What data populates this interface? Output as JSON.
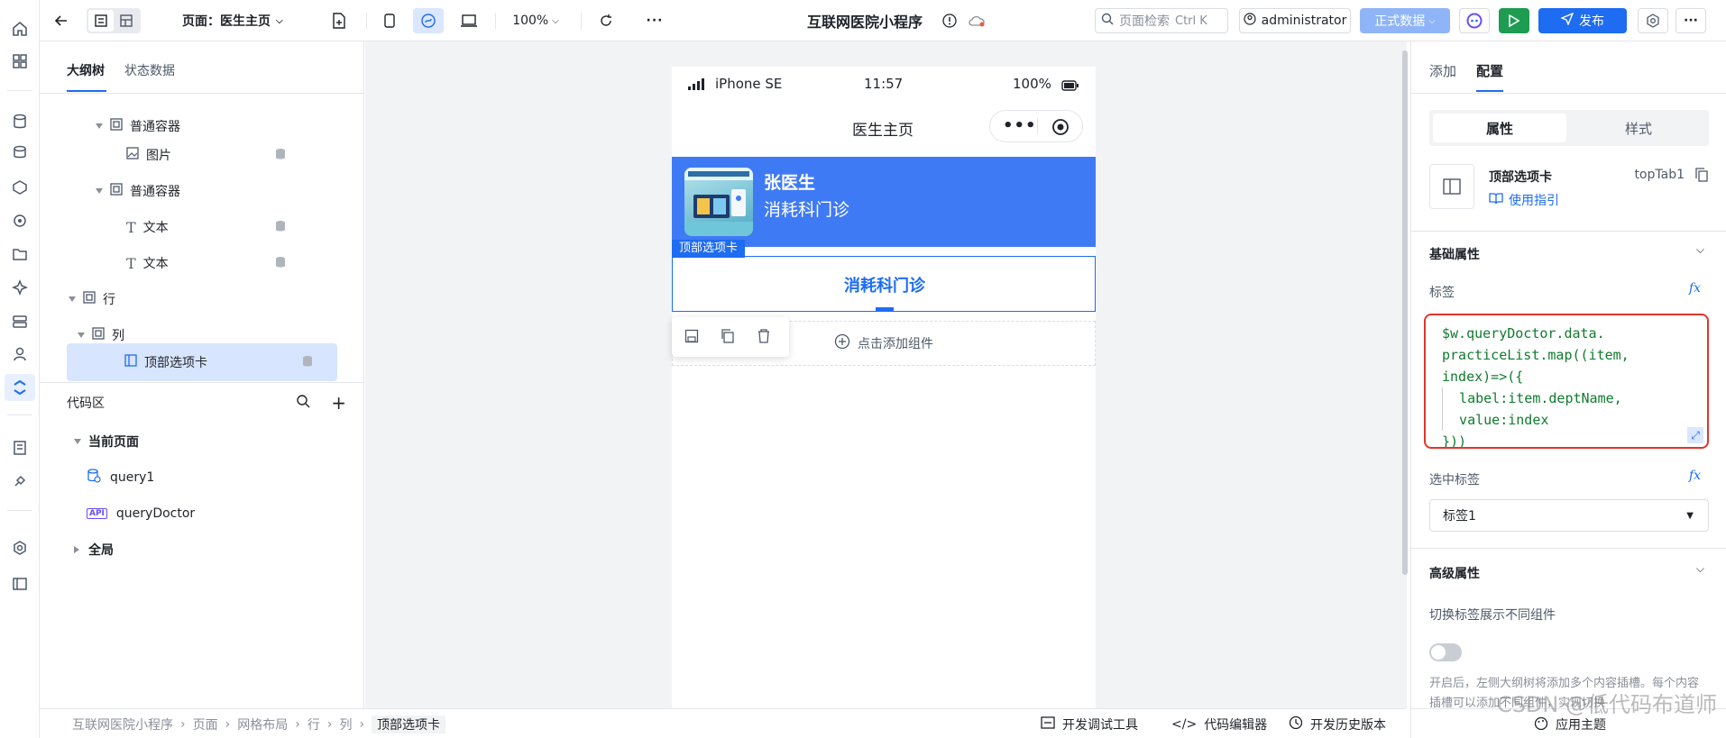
{
  "topbar": {
    "page_label": "页面：医生主页",
    "zoom": "100%",
    "app_title": "互联网医院小程序",
    "search_placeholder": "页面检索",
    "search_shortcut": "Ctrl K",
    "user": "administrator",
    "env": "正式数据",
    "publish": "发布"
  },
  "outline": {
    "tabs": [
      "大纲树",
      "状态数据"
    ],
    "tree": [
      {
        "label": "普通容器",
        "icon": "container-icon"
      },
      {
        "label": "图片",
        "icon": "image-icon"
      },
      {
        "label": "普通容器",
        "icon": "container-icon"
      },
      {
        "label": "文本",
        "icon": "text-icon"
      },
      {
        "label": "文本",
        "icon": "text-icon"
      },
      {
        "label": "行",
        "icon": "container-icon"
      },
      {
        "label": "列",
        "icon": "container-icon"
      },
      {
        "label": "顶部选项卡",
        "icon": "tab-icon"
      }
    ],
    "code_title": "代码区",
    "code_groups": {
      "current": "当前页面",
      "global": "全局"
    },
    "queries": [
      "query1",
      "queryDoctor"
    ]
  },
  "phone": {
    "carrier": "iPhone SE",
    "time": "11:57",
    "battery": "100%",
    "nav_title": "医生主页",
    "doctor_name": "张医生",
    "doctor_dept": "消耗科门诊",
    "tab_tag": "顶部选项卡",
    "tab_label": "消耗科门诊",
    "add_component": "点击添加组件"
  },
  "bottombar": {
    "breadcrumb": [
      "互联网医院小程序",
      "页面",
      "网格布局",
      "行",
      "列",
      "顶部选项卡"
    ],
    "tools": [
      "开发调试工具",
      "代码编辑器",
      "开发历史版本"
    ],
    "theme": "应用主题",
    "watermark": "CSDN @低代码布道师"
  },
  "rpanel": {
    "tabs": [
      "添加",
      "配置"
    ],
    "seg": [
      "属性",
      "样式"
    ],
    "component_name": "顶部选项卡",
    "component_id": "topTab1",
    "guide": "使用指引",
    "basic": "基础属性",
    "label_field": "标签",
    "code_lines": [
      "$w.queryDoctor.data.",
      "practiceList.map((item,",
      "index)=>({",
      "  label:item.deptName,",
      "  value:index",
      "}))"
    ],
    "selected_label": "选中标签",
    "selected_value": "标签1",
    "advanced": "高级属性",
    "switch_label": "切换标签展示不同组件",
    "hint": "开启后，左侧大纲树将添加多个内容插槽。每个内容插槽可以添加不同组件，实现切换"
  }
}
